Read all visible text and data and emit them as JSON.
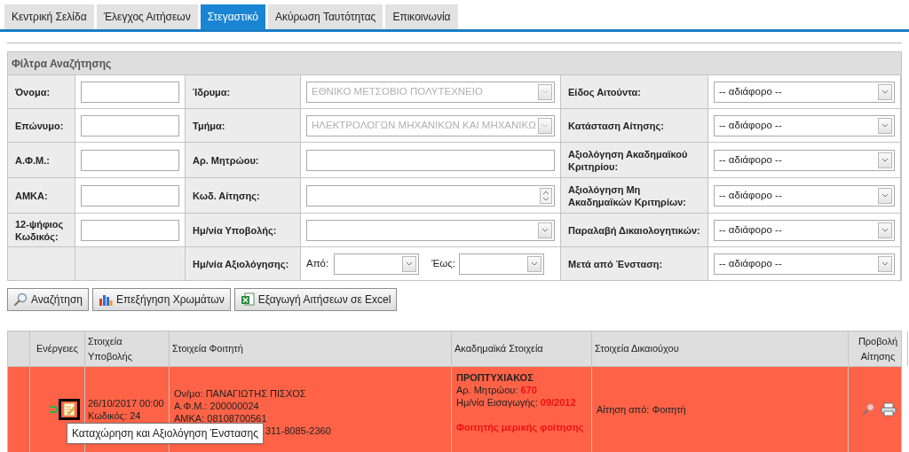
{
  "tabs": [
    {
      "label": "Κεντρική Σελίδα",
      "selected": false
    },
    {
      "label": "Έλεγχος Αιτήσεων",
      "selected": false
    },
    {
      "label": "Στεγαστικό",
      "selected": true
    },
    {
      "label": "Ακύρωση Ταυτότητας",
      "selected": false
    },
    {
      "label": "Επικοινωνία",
      "selected": false
    }
  ],
  "filters": {
    "title": "Φίλτρα Αναζήτησης",
    "rows": [
      [
        {
          "kind": "text",
          "label": "Όνομα:"
        },
        {
          "kind": "select",
          "label": "Ίδρυμα:",
          "value": "ΕΘΝΙΚΟ ΜΕΤΣΟΒΙΟ ΠΟΛΥΤΕΧΝΕΙΟ",
          "disabled": true
        },
        {
          "kind": "select",
          "label": "Είδος Αιτούντα:",
          "value": "-- αδιάφορο --",
          "disabled": false
        }
      ],
      [
        {
          "kind": "text",
          "label": "Επώνυμο:"
        },
        {
          "kind": "select",
          "label": "Τμήμα:",
          "value": "ΗΛΕΚΤΡΟΛΟΓΩΝ ΜΗΧΑΝΙΚΩΝ ΚΑΙ ΜΗΧΑΝΙΚΩ",
          "disabled": true
        },
        {
          "kind": "select",
          "label": "Κατάσταση Αίτησης:",
          "value": "-- αδιάφορο --",
          "disabled": false
        }
      ],
      [
        {
          "kind": "text",
          "label": "Α.Φ.Μ.:"
        },
        {
          "kind": "text",
          "label": "Αρ. Μητρώου:"
        },
        {
          "kind": "select",
          "label": "Αξιολόγηση Ακαδημαϊκού Κριτηρίου:",
          "value": "-- αδιάφορο --",
          "disabled": false
        }
      ],
      [
        {
          "kind": "text",
          "label": "ΑΜΚΑ:"
        },
        {
          "kind": "spinner",
          "label": "Κωδ. Αίτησης:"
        },
        {
          "kind": "select",
          "label": "Αξιολόγηση Μη Ακαδημαϊκών Κριτηρίων:",
          "value": "-- αδιάφορο --",
          "disabled": false
        }
      ],
      [
        {
          "kind": "text",
          "label": "12-ψήφιος Κωδικός:"
        },
        {
          "kind": "select",
          "label": "Ημ/νία Υποβολής:",
          "disabled": false
        },
        {
          "kind": "select",
          "label": "Παραλαβή Δικαιολογητικών:",
          "value": "-- αδιάφορο --",
          "disabled": false
        }
      ],
      [
        {
          "kind": "empty"
        },
        {
          "kind": "date_range",
          "label": "Ημ/νία Αξιολόγησης:",
          "from_label": "Από:",
          "to_label": "Έως:"
        },
        {
          "kind": "select",
          "label": "Μετά από Ένσταση:",
          "value": "-- αδιάφορο --",
          "disabled": false
        }
      ]
    ]
  },
  "buttons": [
    {
      "kind": "search",
      "label": "Αναζήτηση"
    },
    {
      "kind": "colors",
      "label": "Επεξήγηση Χρωμάτων"
    },
    {
      "kind": "excel",
      "label": "Εξαγωγή Αιτήσεων σε Excel"
    }
  ],
  "table": {
    "columns": [
      "Ενέργειες",
      "Στοιχεία Υποβολής",
      "Στοιχεία Φοιτητή",
      "Ακαδημαϊκά Στοιχεία",
      "Στοιχεία Δικαιούχου",
      "Προβολή Αίτησης"
    ],
    "rows": [
      {
        "color": "#ff6347",
        "submission": [
          "26/10/2017 00:00",
          "Κωδικός: 24"
        ],
        "student": [
          "Ον/μο: ΠΑΝΑΓΙΩΤΗΣ ΠΙΣΧΟΣ",
          "Α.Φ.Μ.: 200000024",
          "ΑΜΚΑ: 08108700561",
          "311-8085-2360"
        ],
        "academic": {
          "level": "ΠΡΟΠΤΥΧΙΑΚΟΣ",
          "lines": [
            {
              "label": "Αρ. Μητρώου:",
              "value": "670"
            },
            {
              "label": "Ημ/νία Εισαγωγής:",
              "value": "09/2012"
            }
          ],
          "note": "Φοιτητής μερικής φοίτησης"
        },
        "beneficiary": "Αίτηση από: Φοιτητή"
      }
    ]
  },
  "tooltip": "Καταχώρηση και Αξιολόγηση Ένστασης"
}
